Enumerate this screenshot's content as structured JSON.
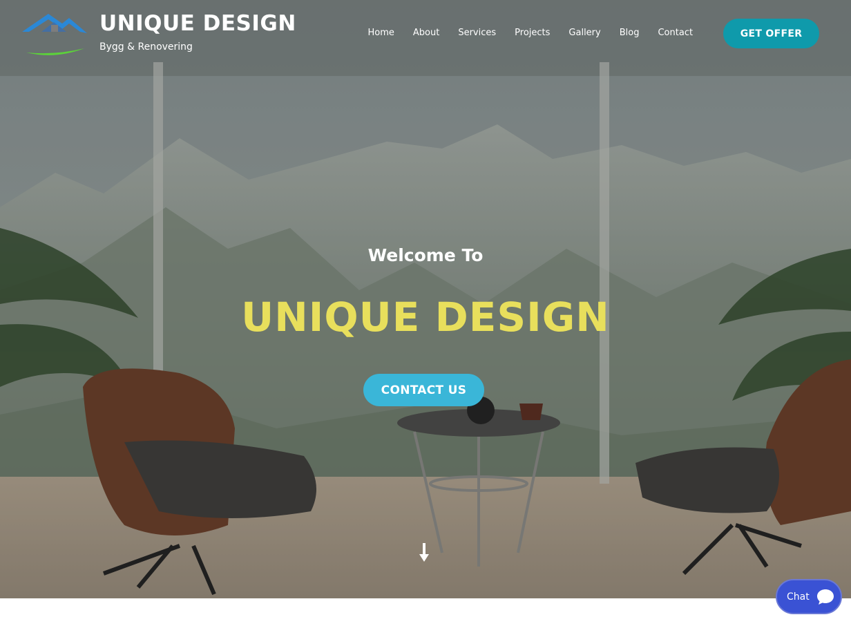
{
  "brand": {
    "title": "UNIQUE DESIGN",
    "subtitle": "Bygg & Renovering"
  },
  "nav": {
    "items": [
      "Home",
      "About",
      "Services",
      "Projects",
      "Gallery",
      "Blog",
      "Contact"
    ],
    "cta_label": "GET OFFER"
  },
  "hero": {
    "welcome": "Welcome To",
    "headline": "UNIQUE DESIGN",
    "cta_label": "CONTACT US"
  },
  "chat": {
    "label": "Chat"
  },
  "colors": {
    "accent_teal": "#0f9aab",
    "contact_button": "#3ab6d8",
    "headline_yellow": "#e8df5c",
    "chat_blue": "#3a52d4"
  },
  "icons": [
    "logo-roof-icon",
    "scroll-down-arrow-icon",
    "chat-bubble-icon"
  ]
}
